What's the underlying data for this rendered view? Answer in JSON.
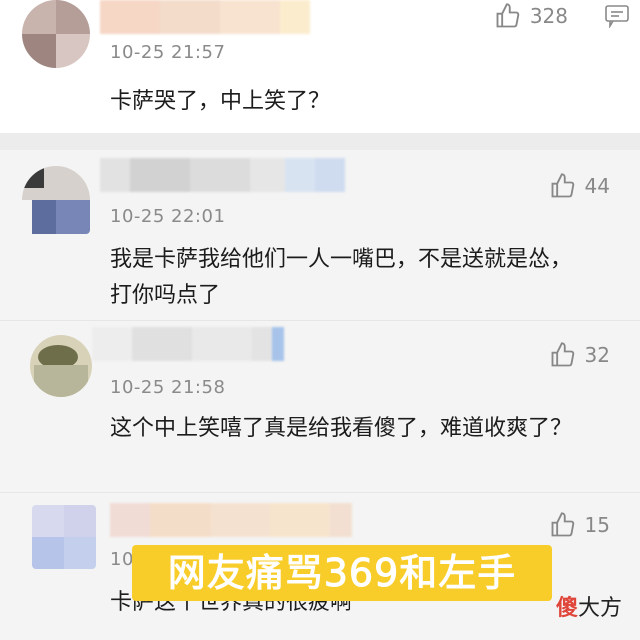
{
  "comments": [
    {
      "time": "10-25 21:57",
      "likes": "328",
      "text": "卡萨哭了，中上笑了？"
    },
    {
      "time": "10-25 22:01",
      "likes": "44",
      "text": "我是卡萨我给他们一人一嘴巴，不是送就是怂，打你吗点了"
    },
    {
      "time": "10-25 21:58",
      "likes": "32",
      "text": "这个中上笑嘻了真是给我看傻了，难道收爽了？"
    },
    {
      "time": "10",
      "likes": "15",
      "text": "卡萨这个世界真的很疲啊"
    }
  ],
  "caption": "网友痛骂369和左手",
  "logo": {
    "highlight": "傻",
    "rest": "大方"
  },
  "colors": {
    "caption_bg": "#f8cd2a",
    "background": "#f4f4f4",
    "logo_accent": "#e0453a"
  },
  "icons": [
    "thumbs-up-icon",
    "reply-comment-icon"
  ]
}
